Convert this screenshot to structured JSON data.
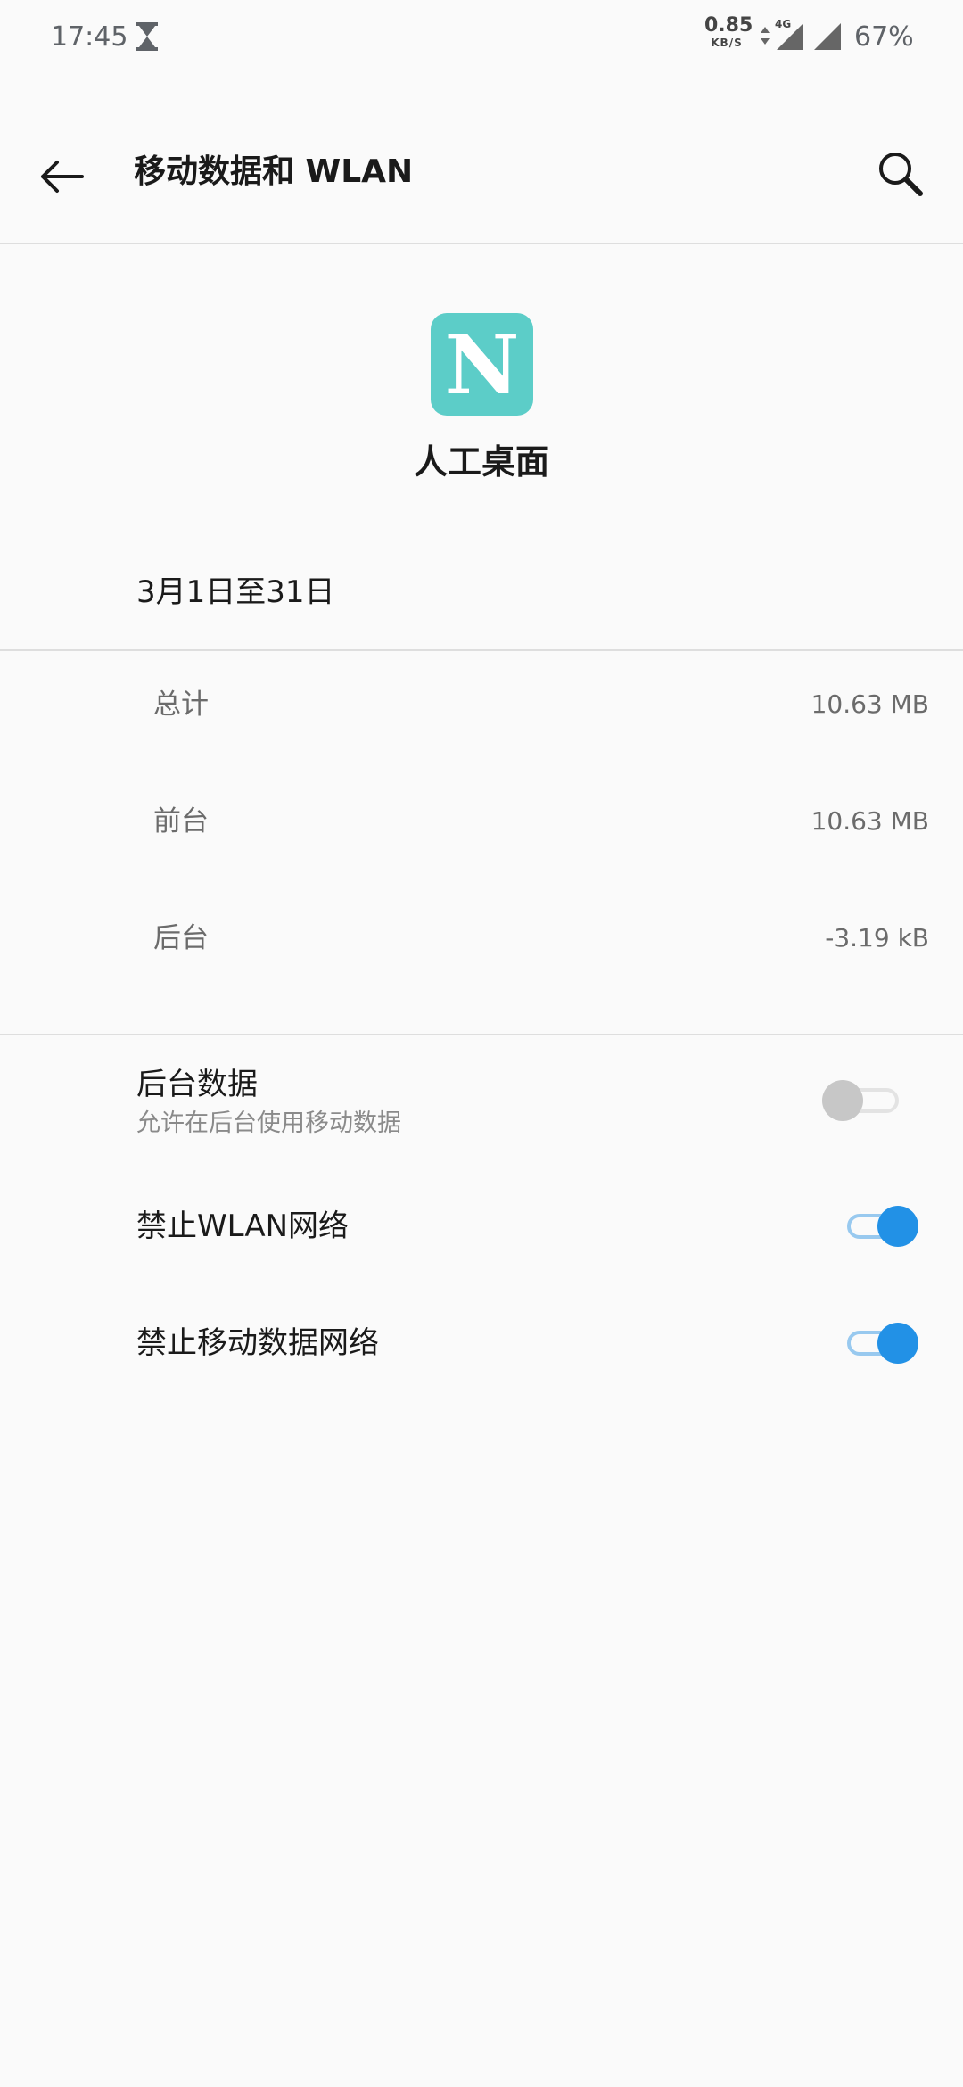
{
  "status_bar": {
    "time": "17:45",
    "net_speed_value": "0.85",
    "net_speed_unit": "KB/S",
    "network_type": "4G",
    "battery": "67%"
  },
  "toolbar": {
    "title": "移动数据和 WLAN",
    "back_icon": "arrow-left-icon",
    "search_icon": "search-icon"
  },
  "app": {
    "icon_letter": "N",
    "icon_color": "#5ccdc8",
    "name": "人工桌面"
  },
  "cycle": {
    "label": "3月1日至31日"
  },
  "usage": {
    "total_label": "总计",
    "total_value": "10.63 MB",
    "foreground_label": "前台",
    "foreground_value": "10.63 MB",
    "background_label": "后台",
    "background_value": "-3.19 kB"
  },
  "settings": {
    "background_data": {
      "title": "后台数据",
      "subtitle": "允许在后台使用移动数据",
      "enabled": false
    },
    "block_wlan": {
      "title": "禁止WLAN网络",
      "enabled": true
    },
    "block_mobile": {
      "title": "禁止移动数据网络",
      "enabled": true
    }
  },
  "colors": {
    "accent": "#2291e6",
    "accent_track": "#98c9ef",
    "background": "#fafafa"
  }
}
